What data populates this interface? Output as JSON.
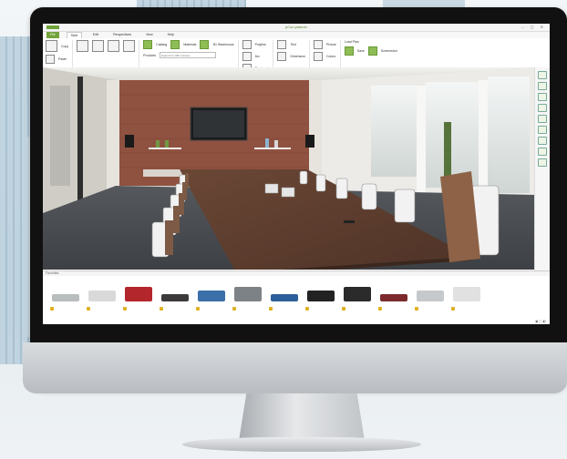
{
  "app": {
    "title": "pCon.planner",
    "window_buttons": "– ▢ ✕"
  },
  "ribbon_tabs": [
    "File",
    "Start",
    "Edit",
    "Perspectives",
    "View",
    "Help"
  ],
  "ribbon": {
    "groups": [
      {
        "name": "clipboard",
        "labels": [
          "Copy",
          "Paste"
        ]
      },
      {
        "name": "views",
        "labels": [
          "Plan",
          "Front",
          "Side",
          "3D"
        ]
      },
      {
        "name": "insert",
        "labels": [
          "Catalog",
          "Materials",
          "3D Warehouse"
        ]
      },
      {
        "name": "search",
        "labels": [
          "Products"
        ],
        "placeholder": "Search for OBJ content"
      },
      {
        "name": "draw",
        "labels": [
          "Polyline",
          "Arc",
          "Rectangle"
        ]
      },
      {
        "name": "annotate",
        "labels": [
          "Text",
          "Dimension"
        ]
      },
      {
        "name": "layer",
        "labels": [
          "Picture",
          "Colors"
        ]
      },
      {
        "name": "export",
        "labels": [
          "Load Plan",
          "Save",
          "Screenshot"
        ]
      }
    ]
  },
  "catalog": {
    "header": "Favorites",
    "items": [
      {
        "name": "sofa-grey",
        "color": "#b9bdbd"
      },
      {
        "name": "side-table-white",
        "color": "#d9d9d9"
      },
      {
        "name": "armchair-red",
        "color": "#b3262b"
      },
      {
        "name": "sideboard-dark",
        "color": "#3d3a3b"
      },
      {
        "name": "sofa-blue",
        "color": "#3a6fa8"
      },
      {
        "name": "cabinet-grey",
        "color": "#7d8286"
      },
      {
        "name": "chair-blue",
        "color": "#2d5f9a"
      },
      {
        "name": "table-black",
        "color": "#222222"
      },
      {
        "name": "chair-black",
        "color": "#2b2b2b"
      },
      {
        "name": "lounge-chair-red",
        "color": "#7c2a2d"
      },
      {
        "name": "bench-grey",
        "color": "#c6c9cb"
      },
      {
        "name": "sofa-white",
        "color": "#e1e1e1"
      }
    ]
  },
  "colors": {
    "accent": "#73a33b",
    "wall_brick": "#8f5140",
    "table_wood": "#5b3d2f",
    "carpet": "#4a4d52"
  }
}
